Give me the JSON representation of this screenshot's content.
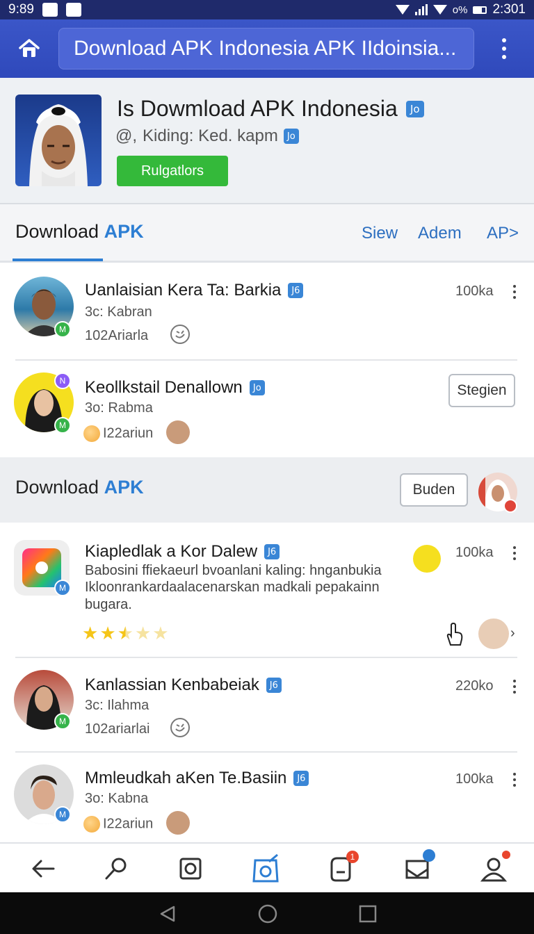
{
  "status_bar": {
    "time_left": "9:89",
    "time_right": "2:301",
    "net": "o%"
  },
  "app_bar": {
    "url_text": "Download APK Indonesia APK IIdoinsia...",
    "home_icon": "home-icon",
    "menu_icon": "more-vertical-icon"
  },
  "profile": {
    "title": "Is Dowmload APK Indonesia",
    "verify_mark": "Jo",
    "subtitle_prefix": "@,",
    "subtitle": "Kiding: Ked. kapm",
    "sub_verify_mark": "Jo",
    "button_label": "Rulgatlors"
  },
  "tabs": {
    "main_prefix": "Download",
    "main_accent": "APK",
    "links": [
      "Siew",
      "Adem",
      "AP>"
    ]
  },
  "rows": [
    {
      "name": "Uanlaisian Kera Ta: Barkia",
      "verify": "J6",
      "sub": "3c: Kabran",
      "meta": "102Ariarla",
      "count": "100ka"
    },
    {
      "name": "Keollkstail Denallown",
      "verify": "Jo",
      "sub": "3o: Rabma",
      "meta": "I22ariun",
      "button": "Stegien"
    }
  ],
  "section": {
    "prefix": "Download",
    "accent": "APK",
    "button": "Buden"
  },
  "app_item": {
    "name": "Kiapledlak a Kor Dalew",
    "verify": "J6",
    "desc1": "Babosini ffiekaeurl bvoanlani kaling: hnganbukia",
    "desc2": "Ikloonrankardaalacenarskan madkali pepakainn",
    "desc3": "bugara.",
    "count": "100ka",
    "rating": 2.5,
    "stars_max": 5
  },
  "rows2": [
    {
      "name": "Kanlassian Kenbabeiak",
      "verify": "J6",
      "sub": "3c: Ilahma",
      "meta": "102ariarlai",
      "count": "220ko"
    },
    {
      "name": "Mmleudkah aKen Te.Basiin",
      "verify": "J6",
      "sub": "3o: Kabna",
      "meta": "I22ariun",
      "count": "100ka"
    }
  ],
  "bottom_nav": {
    "items": [
      "back-arrow-icon",
      "search-icon",
      "square-icon",
      "camera-edit-icon",
      "notification-icon",
      "inbox-icon",
      "profile-icon"
    ],
    "badge_count": "1"
  },
  "colors": {
    "appbar": "#3b56c8",
    "accent": "#2d7ed3",
    "green": "#34b93a"
  }
}
